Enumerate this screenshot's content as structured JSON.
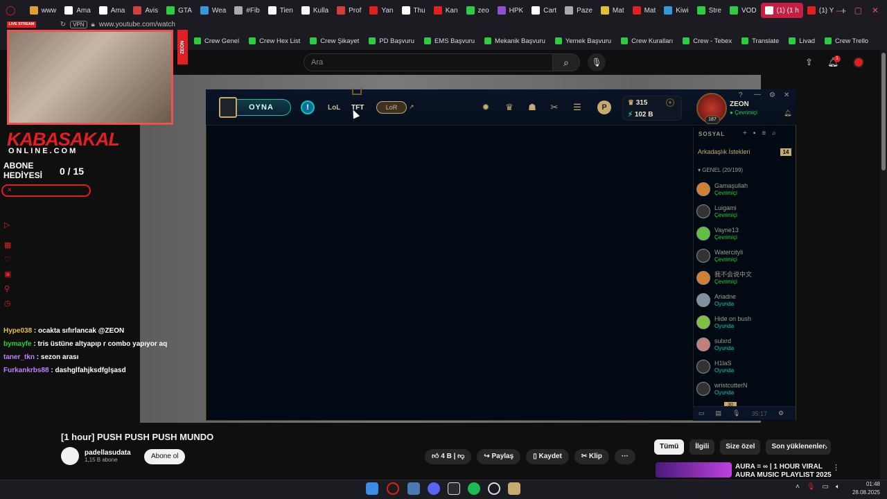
{
  "browser": {
    "tabs": [
      {
        "label": "www",
        "color": "#e0a030"
      },
      {
        "label": "Ama",
        "color": "#ffffff"
      },
      {
        "label": "Ama",
        "color": "#ffffff"
      },
      {
        "label": "Avis",
        "color": "#d04040"
      },
      {
        "label": "GTA",
        "color": "#2ecc40"
      },
      {
        "label": "Wea",
        "color": "#3498db"
      },
      {
        "label": "#Fib",
        "color": "#aaaaaa"
      },
      {
        "label": "Tien",
        "color": "#ffffff"
      },
      {
        "label": "Kulla",
        "color": "#ffffff"
      },
      {
        "label": "Prof",
        "color": "#d04040"
      },
      {
        "label": "Yan",
        "color": "#e02020"
      },
      {
        "label": "Thu",
        "color": "#ffffff"
      },
      {
        "label": "Kan",
        "color": "#e02020"
      },
      {
        "label": "zeo",
        "color": "#2ecc40"
      },
      {
        "label": "HPK",
        "color": "#9050d0"
      },
      {
        "label": "Cart",
        "color": "#ffffff"
      },
      {
        "label": "Paze",
        "color": "#aaaaaa"
      },
      {
        "label": "Mat",
        "color": "#e0c030"
      },
      {
        "label": "Mat",
        "color": "#e02020"
      },
      {
        "label": "Kiwi",
        "color": "#3498db"
      },
      {
        "label": "Stre",
        "color": "#2ecc40"
      },
      {
        "label": "VOD",
        "color": "#2ecc40"
      },
      {
        "label": "(1) (1 h",
        "color": "#ffffff",
        "active": true
      },
      {
        "label": "(1) Y",
        "color": "#e02020"
      }
    ],
    "url": "www.youtube.com/watch",
    "vpn_label": "VPN",
    "bookmarks": [
      "Crew Genel",
      "Crew Hex List",
      "Crew Şikayet",
      "PD Başvuru",
      "EMS Başvuru",
      "Mekanik Başvuru",
      "Yemek Başvuru",
      "Crew Kuralları",
      "Crew - Tebex",
      "Translate",
      "Livad",
      "Crew Trello"
    ]
  },
  "youtube": {
    "search_placeholder": "Ara",
    "video_title": "[1 hour] PUSH PUSH PUSH MUNDO",
    "channel_name": "padellasudata",
    "channel_subs": "1,15 B abone",
    "subscribe_label": "Abone ol",
    "like_count": "4 B",
    "share_label": "Paylaş",
    "save_label": "Kaydet",
    "clip_label": "Klip",
    "more_label": "···",
    "notif_count": "1",
    "chips": [
      "Tümü",
      "İlgili",
      "Size özel",
      "Son yüklenenler"
    ],
    "rec_title_1": "AURA = ∞ | 1 HOUR VIRAL",
    "rec_title_2": "AURA MUSIC PLAYLIST 2025"
  },
  "overlay": {
    "live_badge": "LIVE STREAM",
    "webcam_side_text": "ZEON",
    "brand": "KABASAKAL",
    "brand_sub": "ONLINE.COM",
    "abone_line1": "ABONE",
    "abone_line2": "HEDİYESİ",
    "sub_progress": "0 / 15",
    "chat": [
      {
        "user": "Hype038",
        "msg": "ocakta sıfırlancak @ZEON",
        "color": "#e0c040"
      },
      {
        "user": "bymayfe",
        "msg": "tris üstüne altyapıp r combo yapıyor aq",
        "color": "#2ecc40"
      },
      {
        "user": "taner_tkn",
        "msg": "sezon arası",
        "color": "#c080ff"
      },
      {
        "user": "Furkankrbs88",
        "msg": "dashglfahjksdfglşasd",
        "color": "#c080ff"
      }
    ]
  },
  "lol_client": {
    "play_label": "OYNA",
    "nav_lol": "LoL",
    "nav_tft": "TFT",
    "nav_lor": "LoR",
    "rp": "315",
    "be": "102 B",
    "summoner": "ZEON",
    "summoner_status": "Çevrimiçi",
    "level": "187",
    "social_label": "SOSYAL",
    "friend_requests_label": "Arkadaşlık İstekleri",
    "friend_requests_count": "14",
    "group_label": "GENEL (20/199)",
    "friends": [
      {
        "name": "Gamaşullah",
        "status": "Çevrimiçi",
        "color": "#2ecc40",
        "av": "#d08030"
      },
      {
        "name": "Luigami",
        "status": "Çevrimiçi",
        "color": "#2ecc40",
        "av": "#333333"
      },
      {
        "name": "Vayne13",
        "status": "Çevrimiçi",
        "color": "#2ecc40",
        "av": "#60c040"
      },
      {
        "name": "Watercityli",
        "status": "Çevrimiçi",
        "color": "#2ecc40",
        "av": "#333333"
      },
      {
        "name": "我不会说中文",
        "status": "Çevrimiçi",
        "color": "#2ecc40",
        "av": "#d08030"
      },
      {
        "name": "Ariadne",
        "status": "Oyunda",
        "color": "#0ac8b9",
        "av": "#8090a0"
      },
      {
        "name": "Hide on bush",
        "status": "Oyunda",
        "color": "#0ac8b9",
        "av": "#80c040"
      },
      {
        "name": "sulxrd",
        "status": "Oyunda",
        "color": "#0ac8b9",
        "av": "#c08080"
      },
      {
        "name": "H1laS",
        "status": "Oyunda",
        "color": "#0ac8b9",
        "av": "#333333"
      },
      {
        "name": "wristcutterN",
        "status": "Oyunda",
        "color": "#0ac8b9",
        "av": "#333333"
      }
    ],
    "badge_30": "30",
    "time": "35:17"
  },
  "taskbar": {
    "time": "01:48",
    "date": "28.08.2025"
  }
}
